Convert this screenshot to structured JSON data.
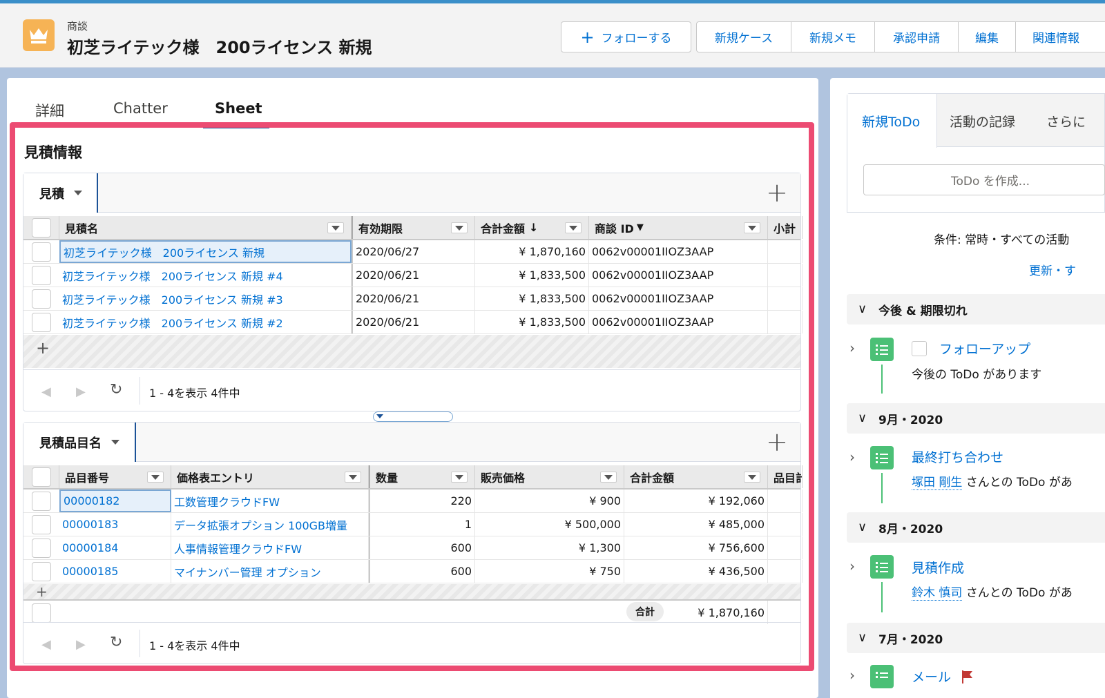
{
  "header": {
    "object_type": "商談",
    "record_title": "初芝ライテック様　200ライセンス 新規",
    "follow_label": "フォローする",
    "buttons": [
      "新規ケース",
      "新規メモ",
      "承認申請",
      "編集",
      "関連情報"
    ]
  },
  "tabs": [
    "詳細",
    "Chatter",
    "Sheet"
  ],
  "sheet": {
    "section_title": "見積情報",
    "quotes": {
      "tab_label": "見積",
      "columns": [
        "見積名",
        "有効期限",
        "合計金額",
        "商談 ID",
        "小計"
      ],
      "rows": [
        {
          "name": "初芝ライテック様　200ライセンス 新規",
          "expiry": "2020/06/27",
          "total": "¥ 1,870,160",
          "opp_id": "0062v00001IIOZ3AAP"
        },
        {
          "name": "初芝ライテック様　200ライセンス 新規 #4",
          "expiry": "2020/06/21",
          "total": "¥ 1,833,500",
          "opp_id": "0062v00001IIOZ3AAP"
        },
        {
          "name": "初芝ライテック様　200ライセンス 新規 #3",
          "expiry": "2020/06/21",
          "total": "¥ 1,833,500",
          "opp_id": "0062v00001IIOZ3AAP"
        },
        {
          "name": "初芝ライテック様　200ライセンス 新規 #2",
          "expiry": "2020/06/21",
          "total": "¥ 1,833,500",
          "opp_id": "0062v00001IIOZ3AAP"
        }
      ],
      "pager_info": "1 - 4を表示 4件中"
    },
    "line_items": {
      "tab_label": "見積品目名",
      "columns": [
        "品目番号",
        "価格表エントリ",
        "数量",
        "販売価格",
        "合計金額",
        "品目計"
      ],
      "rows": [
        {
          "no": "00000182",
          "entry": "工数管理クラウドFW",
          "qty": "220",
          "price": "¥ 900",
          "total": "¥ 192,060"
        },
        {
          "no": "00000183",
          "entry": "データ拡張オプション 100GB増量",
          "qty": "1",
          "price": "¥ 500,000",
          "total": "¥ 485,000"
        },
        {
          "no": "00000184",
          "entry": "人事情報管理クラウドFW",
          "qty": "600",
          "price": "¥ 1,300",
          "total": "¥ 756,600"
        },
        {
          "no": "00000185",
          "entry": "マイナンバー管理 オプション",
          "qty": "600",
          "price": "¥ 750",
          "total": "¥ 436,500"
        }
      ],
      "sum_label": "合計",
      "sum_value": "¥ 1,870,160",
      "pager_info": "1 - 4を表示 4件中"
    }
  },
  "activity": {
    "tabs": [
      "新規ToDo",
      "活動の記録",
      "さらに"
    ],
    "todo_placeholder": "ToDo を作成...",
    "filter_text": "条件: 常時・すべての活動",
    "refresh_text": "更新・す",
    "groups": [
      {
        "label": "今後 & 期限切れ",
        "item_title": "フォローアップ",
        "item_sub": "今後の ToDo があります"
      },
      {
        "label": "9月・2020",
        "item_title": "最終打ち合わせ",
        "item_who": "塚田 剛生",
        "item_rest": " さんとの ToDo があ"
      },
      {
        "label": "8月・2020",
        "item_title": "見積作成",
        "item_who": "鈴木 慎司",
        "item_rest": " さんとの ToDo があ"
      },
      {
        "label": "7月・2020",
        "item_title": "メール"
      }
    ]
  }
}
